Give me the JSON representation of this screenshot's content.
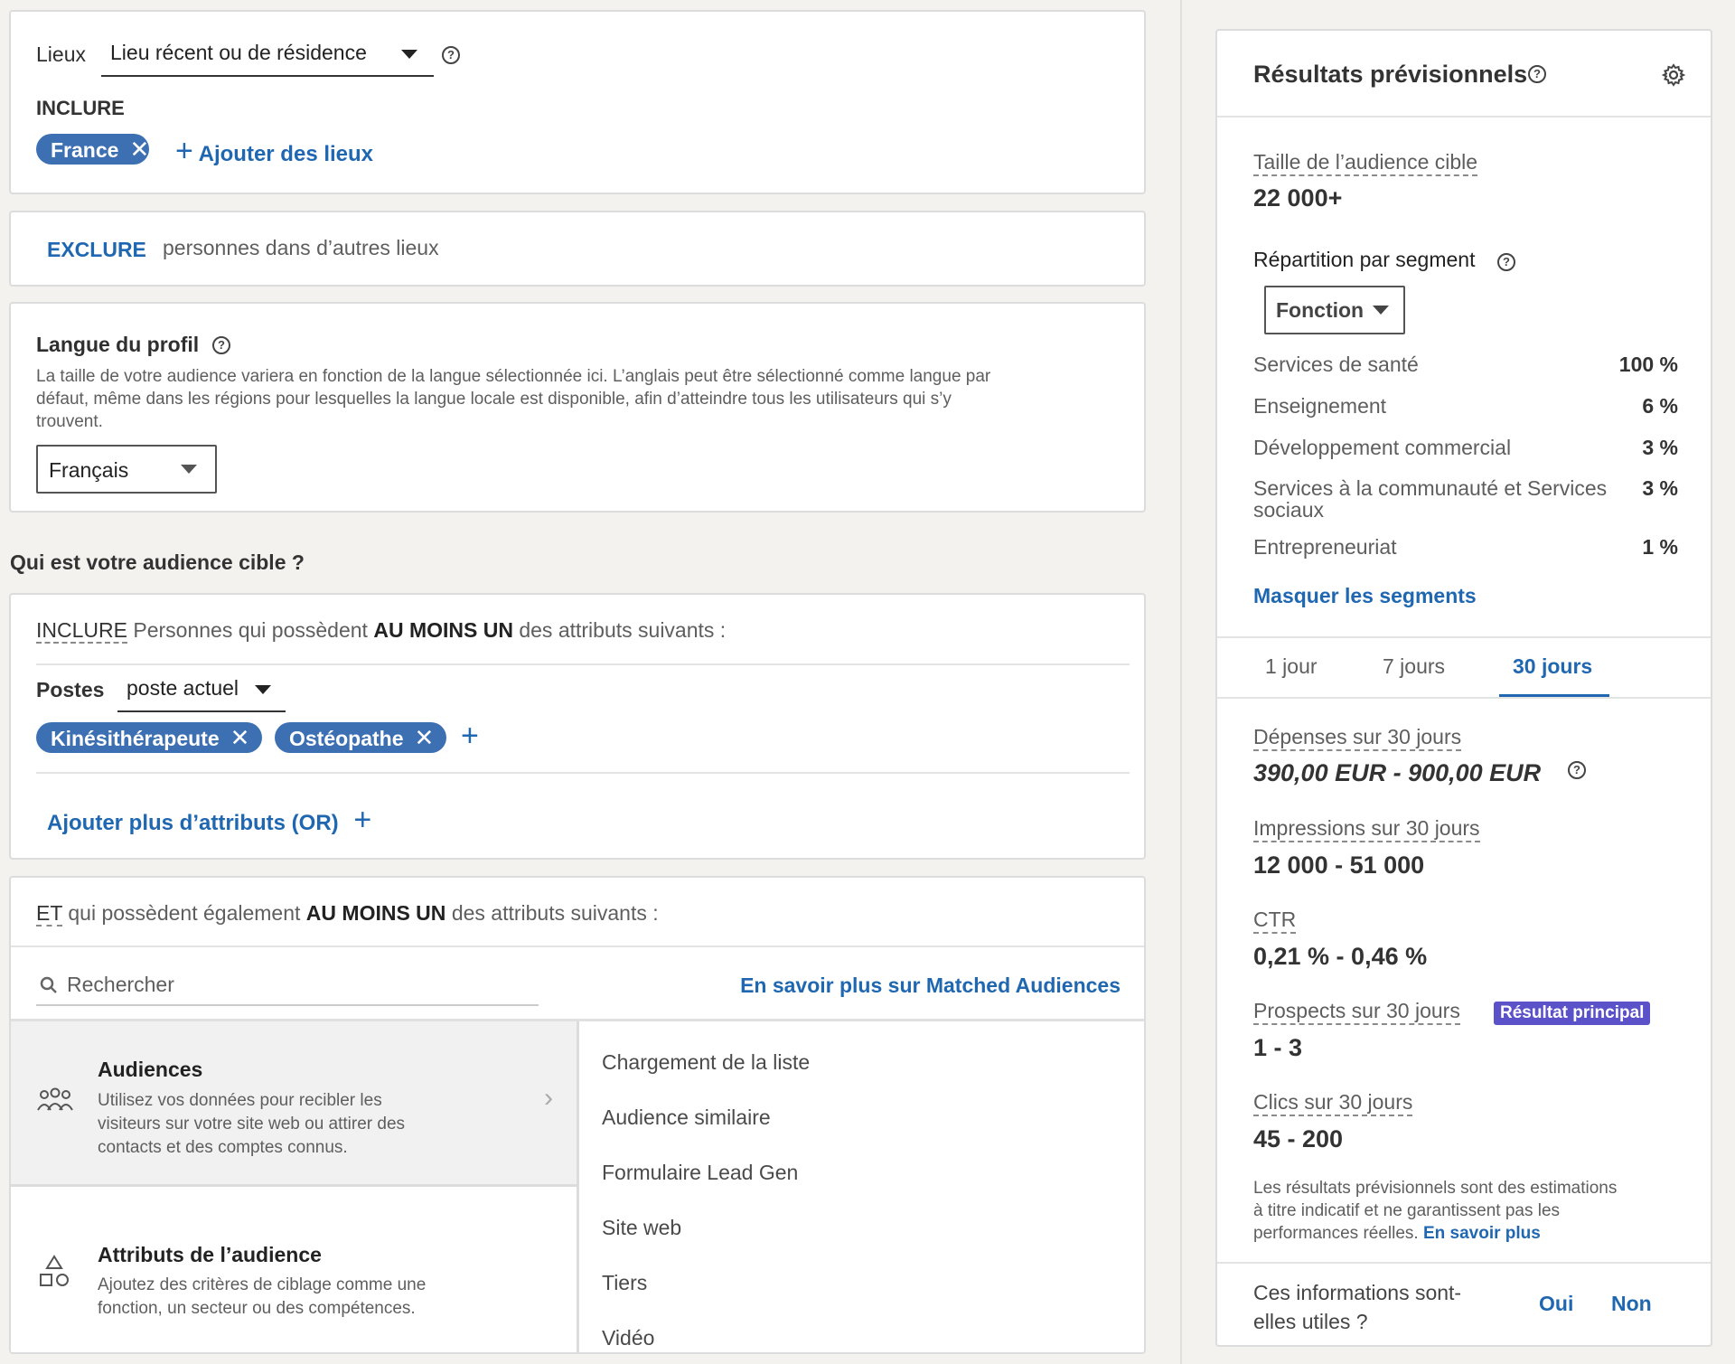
{
  "locations": {
    "label": "Lieux",
    "dropdown": "Lieu récent ou de résidence",
    "include_label": "INCLURE",
    "chips": [
      "France"
    ],
    "add_label": "Ajouter des lieux"
  },
  "exclude": {
    "label": "EXCLURE",
    "text": "personnes dans d’autres lieux"
  },
  "profile_language": {
    "title": "Langue du profil",
    "description_1": "La taille de votre audience variera en fonction de la langue sélectionnée ici. L’anglais peut être sélectionné comme langue par",
    "description_2": "défaut, même dans les régions pour lesquelles la langue locale est disponible, afin d’atteindre tous les utilisateurs qui s’y",
    "description_3": "trouvent.",
    "selected": "Français"
  },
  "audience_heading": "Qui est votre audience cible ?",
  "include_block": {
    "label": "INCLURE",
    "text_before": "Personnes qui possèdent",
    "emphasis": "AU MOINS UN",
    "text_after": "des attributs suivants :",
    "postes_label": "Postes",
    "postes_dropdown": "poste actuel",
    "chips": [
      "Kinésithérapeute",
      "Ostéopathe"
    ],
    "add_more": "Ajouter plus d’attributs (OR)"
  },
  "and_block": {
    "label": "ET",
    "text_before": "qui possèdent également",
    "emphasis": "AU MOINS UN",
    "text_after": "des attributs suivants :",
    "search_placeholder": "Rechercher",
    "learn_more": "En savoir plus sur Matched Audiences",
    "categories": [
      {
        "title": "Audiences",
        "desc_1": "Utilisez vos données pour recibler les",
        "desc_2": "visiteurs sur votre site web ou attirer des",
        "desc_3": "contacts et des comptes connus."
      },
      {
        "title": "Attributs de l’audience",
        "desc_1": "Ajoutez des critères de ciblage comme une",
        "desc_2": "fonction, un secteur ou des compétences."
      }
    ],
    "options": [
      "Chargement de la liste",
      "Audience similaire",
      "Formulaire Lead Gen",
      "Site web",
      "Tiers",
      "Vidéo"
    ]
  },
  "forecast": {
    "title": "Résultats prévisionnels",
    "audience_size_label": "Taille de l’audience cible",
    "audience_size": "22 000+",
    "segment_label": "Répartition par segment",
    "segment_dropdown": "Fonction",
    "segments": [
      {
        "name": "Services de santé",
        "value": "100 %"
      },
      {
        "name": "Enseignement",
        "value": "6 %"
      },
      {
        "name": "Développement commercial",
        "value": "3 %"
      },
      {
        "name_1": "Services à la communauté et Services",
        "name_2": "sociaux",
        "value": "3 %"
      },
      {
        "name": "Entrepreneuriat",
        "value": "1 %"
      }
    ],
    "hide_segments": "Masquer les segments",
    "tabs": [
      "1 jour",
      "7 jours",
      "30 jours"
    ],
    "active_tab": "30 jours",
    "spend_label": "Dépenses sur 30 jours",
    "spend_value": "390,00 EUR - 900,00 EUR",
    "impressions_label": "Impressions sur 30 jours",
    "impressions_value": "12 000 - 51 000",
    "ctr_label": "CTR",
    "ctr_value": "0,21 % - 0,46 %",
    "leads_label": "Prospects sur 30 jours",
    "leads_badge": "Résultat principal",
    "leads_value": "1 - 3",
    "clicks_label": "Clics sur 30 jours",
    "clicks_value": "45 - 200",
    "disclaimer_1": "Les résultats prévisionnels sont des estimations",
    "disclaimer_2": "à titre indicatif et ne garantissent pas les",
    "disclaimer_3": "performances réelles.",
    "disclaimer_link": "En savoir plus",
    "feedback_q1": "Ces informations sont-",
    "feedback_q2": "elles utiles ?",
    "yes": "Oui",
    "no": "Non",
    "colors": {
      "accent": "#1f67b1",
      "badge": "#5b51c9"
    }
  }
}
